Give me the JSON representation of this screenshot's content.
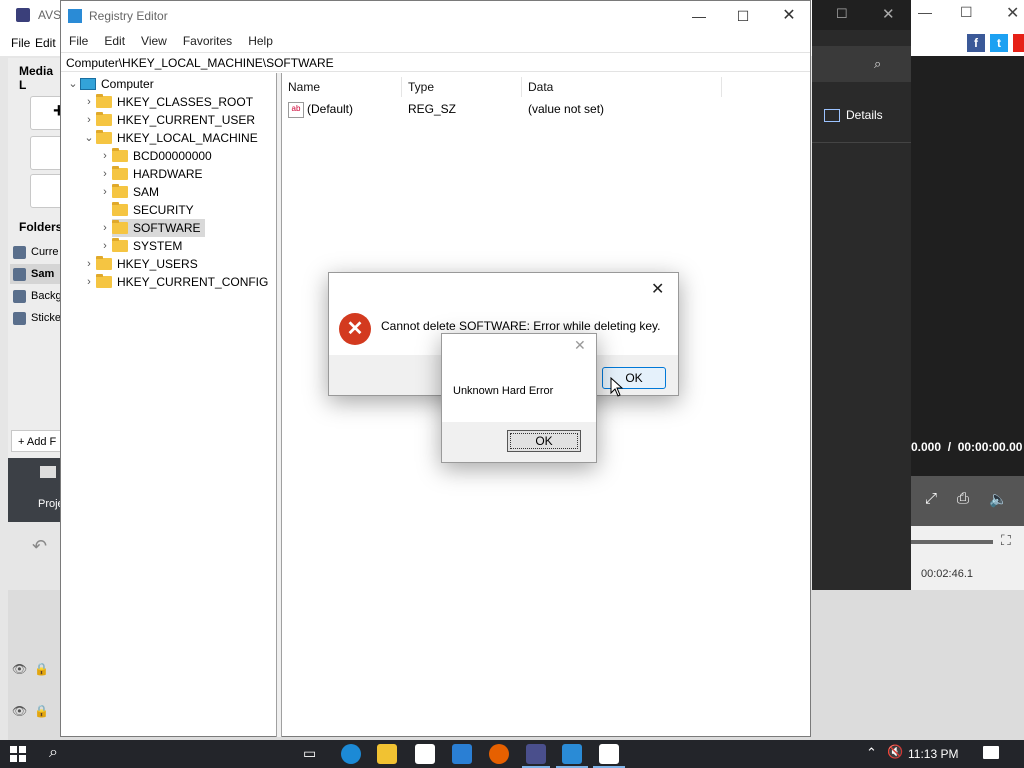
{
  "avs": {
    "title": "AVS",
    "menu": [
      "File",
      "Edit"
    ],
    "media_label": "Media L",
    "folders_label": "Folders",
    "folder_items": [
      "Curre",
      "Sam",
      "Backg",
      "Sticke"
    ],
    "add_button": "Add F",
    "project_label": "Proje",
    "details_label": "Details",
    "time_readout": "0.000  /  00:00:00.00",
    "timeline_time": "00:02:46.1"
  },
  "registry": {
    "title": "Registry Editor",
    "menu": [
      "File",
      "Edit",
      "View",
      "Favorites",
      "Help"
    ],
    "address": "Computer\\HKEY_LOCAL_MACHINE\\SOFTWARE",
    "tree": {
      "root": "Computer",
      "hives": [
        "HKEY_CLASSES_ROOT",
        "HKEY_CURRENT_USER",
        "HKEY_LOCAL_MACHINE",
        "HKEY_USERS",
        "HKEY_CURRENT_CONFIG"
      ],
      "hklm_children": [
        "BCD00000000",
        "HARDWARE",
        "SAM",
        "SECURITY",
        "SOFTWARE",
        "SYSTEM"
      ],
      "selected": "SOFTWARE"
    },
    "columns": [
      "Name",
      "Type",
      "Data"
    ],
    "values": [
      {
        "name": "(Default)",
        "type": "REG_SZ",
        "data": "(value not set)"
      }
    ]
  },
  "dialog1": {
    "message": "Cannot delete SOFTWARE:  Error while deleting key.",
    "ok_label": "OK"
  },
  "dialog2": {
    "message": "Unknown Hard Error",
    "ok_label": "OK"
  },
  "taskbar": {
    "time": "11:13 PM"
  },
  "colors": {
    "error_red": "#d33a1f",
    "taskbar": "#23252a",
    "folder_yellow": "#f5c542",
    "focus_blue": "#0078d7"
  }
}
